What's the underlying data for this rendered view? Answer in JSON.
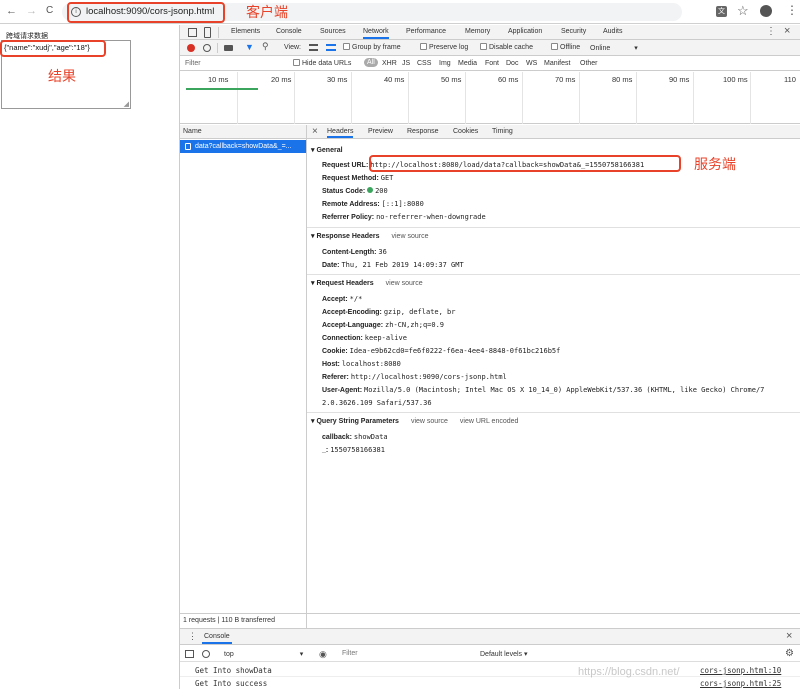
{
  "browser": {
    "url": "localhost:9090/cors-jsonp.html",
    "back_glyph": "←",
    "forward_glyph": "→",
    "reload_glyph": "C"
  },
  "annotations": {
    "client": "客户端",
    "result": "结果",
    "server": "服务端"
  },
  "page": {
    "label": "跨域请求数据",
    "textarea_value": "{\"name\":\"xudj\",\"age\":\"18\"}"
  },
  "devtools": {
    "tabs": [
      "Elements",
      "Console",
      "Sources",
      "Network",
      "Performance",
      "Memory",
      "Application",
      "Security",
      "Audits"
    ],
    "active_tab": "Network",
    "toolbar": {
      "view_label": "View:",
      "group_by_frame": "Group by frame",
      "preserve_log": "Preserve log",
      "disable_cache": "Disable cache",
      "offline": "Offline",
      "online": "Online"
    },
    "filter": {
      "placeholder": "Filter",
      "hide_data_urls": "Hide data URLs",
      "types": [
        "All",
        "XHR",
        "JS",
        "CSS",
        "Img",
        "Media",
        "Font",
        "Doc",
        "WS",
        "Manifest",
        "Other"
      ]
    },
    "timeline_ticks": [
      "10 ms",
      "20 ms",
      "30 ms",
      "40 ms",
      "50 ms",
      "60 ms",
      "70 ms",
      "80 ms",
      "90 ms",
      "100 ms",
      "110"
    ],
    "requests": {
      "column_name": "Name",
      "items": [
        "data?callback=showData&_=..."
      ],
      "summary": "1 requests | 110 B transferred"
    },
    "detail_tabs": [
      "Headers",
      "Preview",
      "Response",
      "Cookies",
      "Timing"
    ],
    "close_glyph": "×",
    "general": {
      "title": "General",
      "request_url_key": "Request URL:",
      "request_url_val": "http://localhost:8080/load/data?callback=showData&_=1550758166381",
      "method_key": "Request Method:",
      "method_val": "GET",
      "status_key": "Status Code:",
      "status_val": "200",
      "remote_key": "Remote Address:",
      "remote_val": "[::1]:8080",
      "referrer_policy_key": "Referrer Policy:",
      "referrer_policy_val": "no-referrer-when-downgrade"
    },
    "response_headers": {
      "title": "Response Headers",
      "view_source": "view source",
      "rows": [
        {
          "key": "Content-Length:",
          "val": "36"
        },
        {
          "key": "Date:",
          "val": "Thu, 21 Feb 2019 14:09:37 GMT"
        }
      ]
    },
    "request_headers": {
      "title": "Request Headers",
      "view_source": "view source",
      "rows": [
        {
          "key": "Accept:",
          "val": "*/*"
        },
        {
          "key": "Accept-Encoding:",
          "val": "gzip, deflate, br"
        },
        {
          "key": "Accept-Language:",
          "val": "zh-CN,zh;q=0.9"
        },
        {
          "key": "Connection:",
          "val": "keep-alive"
        },
        {
          "key": "Cookie:",
          "val": "Idea-e9b62cd0=fe6f0222-f6ea-4ee4-8848-0f61bc216b5f"
        },
        {
          "key": "Host:",
          "val": "localhost:8080"
        },
        {
          "key": "Referer:",
          "val": "http://localhost:9090/cors-jsonp.html"
        }
      ],
      "ua_key": "User-Agent:",
      "ua_val_1": "Mozilla/5.0 (Macintosh; Intel Mac OS X 10_14_0) AppleWebKit/537.36 (KHTML, like Gecko) Chrome/7",
      "ua_val_2": "2.0.3626.109 Safari/537.36"
    },
    "query_params": {
      "title": "Query String Parameters",
      "view_source": "view source",
      "view_url_encoded": "view URL encoded",
      "rows": [
        {
          "key": "callback:",
          "val": "showData"
        },
        {
          "key": "_:",
          "val": "1550758166381"
        }
      ]
    },
    "console_drawer": {
      "tab_label": "Console",
      "context": "top",
      "filter_placeholder": "Filter",
      "levels": "Default levels",
      "logs": [
        {
          "text": "Get Into showData",
          "source": "cors-jsonp.html:10"
        },
        {
          "text": "Get Into success",
          "source": "cors-jsonp.html:25"
        }
      ]
    }
  },
  "watermark": "https://blog.csdn.net/"
}
